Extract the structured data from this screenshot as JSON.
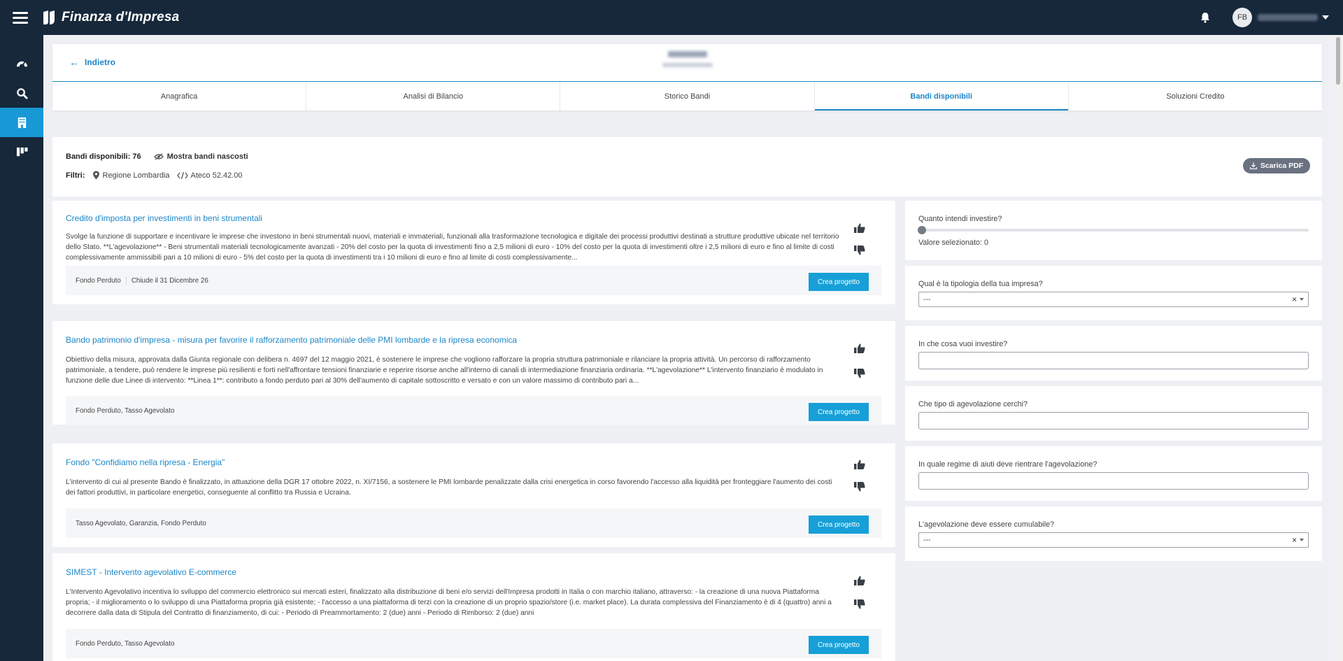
{
  "app": {
    "title": "Finanza d'Impresa"
  },
  "user": {
    "initials": "FB",
    "name": ""
  },
  "colors": {
    "topbar": "#16283a",
    "accent": "#1b87c9",
    "button": "#16a0d7",
    "active_nav": "#1998d6"
  },
  "sidebar": {
    "items": [
      {
        "icon": "dashboard-icon",
        "active": false
      },
      {
        "icon": "search-icon",
        "active": false
      },
      {
        "icon": "building-icon",
        "active": true
      },
      {
        "icon": "board-icon",
        "active": false
      }
    ]
  },
  "header": {
    "back_label": "Indietro",
    "company_name": "",
    "company_sub": "",
    "tabs": [
      {
        "label": "Anagrafica",
        "active": false
      },
      {
        "label": "Analisi di Bilancio",
        "active": false
      },
      {
        "label": "Storico Bandi",
        "active": false
      },
      {
        "label": "Bandi disponibili",
        "active": true
      },
      {
        "label": "Soluzioni Credito",
        "active": false
      }
    ]
  },
  "summary": {
    "bandi_label": "Bandi disponibili: 76",
    "show_hidden": "Mostra bandi nascosti",
    "filters_label": "Filtri:",
    "region": "Regione Lombardia",
    "ateco": "Ateco 52.42.00",
    "pdf_button": "Scarica PDF"
  },
  "bandi": [
    {
      "title": "Credito d'imposta per investimenti in beni strumentali",
      "description": "Svolge la funzione di supportare e incentivare le imprese che investono in beni strumentali nuovi, materiali e immateriali, funzionali alla trasformazione tecnologica e digitale dei processi produttivi destinati a strutture produttive ubicate nel territorio dello Stato. **L'agevolazione** - Beni strumentali materiali tecnologicamente avanzati - 20% del costo per la quota di investimenti fino a 2,5 milioni di euro - 10% del costo per la quota di investimenti oltre i 2,5 milioni di euro e fino al limite di costi complessivamente ammissibili pari a 10 milioni di euro - 5% del costo per la quota di investimenti tra i 10 milioni di euro e fino al limite di costi complessivamente...",
      "tags": "Fondo Perduto",
      "deadline": "Chiude il 31 Dicembre 26",
      "button": "Crea progetto"
    },
    {
      "title": "Bando patrimonio d'impresa - misura per favorire il rafforzamento patrimoniale delle PMI lombarde e la ripresa economica",
      "description": "Obiettivo della misura, approvata dalla Giunta regionale con delibera n. 4697 del 12 maggio 2021, è sostenere le imprese che vogliono rafforzare la propria struttura patrimoniale e rilanciare la propria attività. Un percorso di rafforzamento patrimoniale, a tendere, può rendere le imprese più resilienti e forti nell'affrontare tensioni finanziarie e reperire risorse anche all'interno di canali di intermediazione finanziaria ordinaria. **L'agevolazione** L'intervento finanziario è modulato in funzione delle due Linee di intervento: **Linea 1**: contributo a fondo perduto pari al 30% dell'aumento di capitale sottoscritto e versato e con un valore massimo di contributo pari a...",
      "tags": "Fondo Perduto, Tasso Agevolato",
      "deadline": "",
      "button": "Crea progetto"
    },
    {
      "title": "Fondo \"Confidiamo nella ripresa - Energia\"",
      "description": "L'intervento di cui al presente Bando è finalizzato, in attuazione della DGR 17 ottobre 2022, n. XI/7156, a sostenere le PMI lombarde penalizzate dalla crisi energetica in corso favorendo l'accesso alla liquidità per fronteggiare l'aumento dei costi dei fattori produttivi, in particolare energetici, conseguente al conflitto tra Russia e Ucraina.",
      "tags": "Tasso Agevolato, Garanzia, Fondo Perduto",
      "deadline": "",
      "button": "Crea progetto"
    },
    {
      "title": "SIMEST - Intervento agevolativo E-commerce",
      "description": "L'Intervento Agevolativo incentiva lo sviluppo del commercio elettronico sui mercati esteri, finalizzato alla distribuzione di beni e/o servizi dell'Impresa prodotti in Italia o con marchio italiano, attraverso: - la creazione di una nuova Piattaforma propria; - il miglioramento o lo sviluppo di una Piattaforma propria già esistente; - l'accesso a una piattaforma di terzi con la creazione di un proprio spazio/store (i.e. market place). La durata complessiva del Finanziamento è di 4 (quattro) anni a decorrere dalla data di Stipula del Contratto di finanziamento, di cui: - Periodo di Preammortamento: 2 (due) anni - Periodo di Rimborso: 2 (due) anni",
      "tags": "Fondo Perduto, Tasso Agevolato",
      "deadline": "",
      "button": "Crea progetto"
    }
  ],
  "filters": {
    "invest_question": "Quanto intendi investire?",
    "invest_value_label": "Valore selezionato: 0",
    "invest_value": 0,
    "tipologia_question": "Qual è la tipologia della tua impresa?",
    "tipologia_value": "---",
    "cosa_question": "In che cosa vuoi investire?",
    "cosa_value": "",
    "agevolazione_question": "Che tipo di agevolazione cerchi?",
    "agevolazione_value": "",
    "regime_question": "In quale regime di aiuti deve rientrare l'agevolazione?",
    "regime_value": "",
    "cumulabile_question": "L'agevolazione deve essere cumulabile?",
    "cumulabile_value": "---",
    "clear_symbol": "×"
  }
}
